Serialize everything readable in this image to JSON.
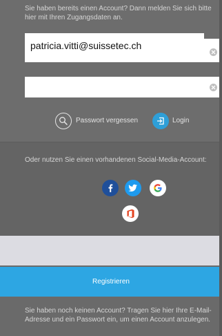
{
  "login": {
    "intro": "Sie haben bereits einen Account? Dann melden Sie sich bitte hier mit Ihren Zugangsdaten an.",
    "email_value": "patricia.vitti@suissetec.ch",
    "password_value": "",
    "forgot_label": "Passwort vergessen",
    "login_label": "Login"
  },
  "social": {
    "intro": "Oder nutzen Sie einen vorhandenen Social-Media-Account:",
    "icons": [
      "facebook-icon",
      "twitter-icon",
      "google-icon",
      "office-icon"
    ]
  },
  "register": {
    "input_value": "",
    "button_label": "Registrieren",
    "intro": "Sie haben noch keinen Account? Tragen Sie hier Ihre E-Mail-Adresse und ein Passwort ein, um einen Account anzulegen."
  },
  "colors": {
    "accent": "#2da6e3",
    "facebook": "#1f4f9a",
    "twitter": "#1e9bef",
    "background": "#6a6a6a"
  }
}
